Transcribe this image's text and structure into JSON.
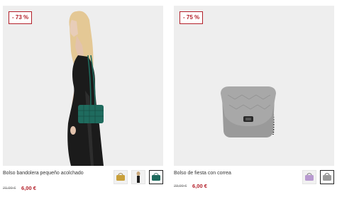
{
  "products": [
    {
      "discount": "- 73 %",
      "title": "Bolso bandolera pequeño acolchado",
      "old_price": "21,99 €",
      "new_price": "6,00 €",
      "swatches": [
        {
          "color": "#c9a03a",
          "icon": "yellow-bag-icon",
          "selected": false
        },
        {
          "color": "#1e1e1e",
          "icon": "black-bag-icon",
          "selected": false
        },
        {
          "color": "#1f6b5e",
          "icon": "green-bag-icon",
          "selected": true
        }
      ]
    },
    {
      "discount": "- 75 %",
      "title": "Bolso de fiesta con correa",
      "old_price": "23,99 €",
      "new_price": "6,00 €",
      "swatches": [
        {
          "color": "#b89ad0",
          "icon": "lilac-bag-icon",
          "selected": false
        },
        {
          "color": "#9a9a9a",
          "icon": "silver-bag-icon",
          "selected": true
        }
      ]
    }
  ]
}
